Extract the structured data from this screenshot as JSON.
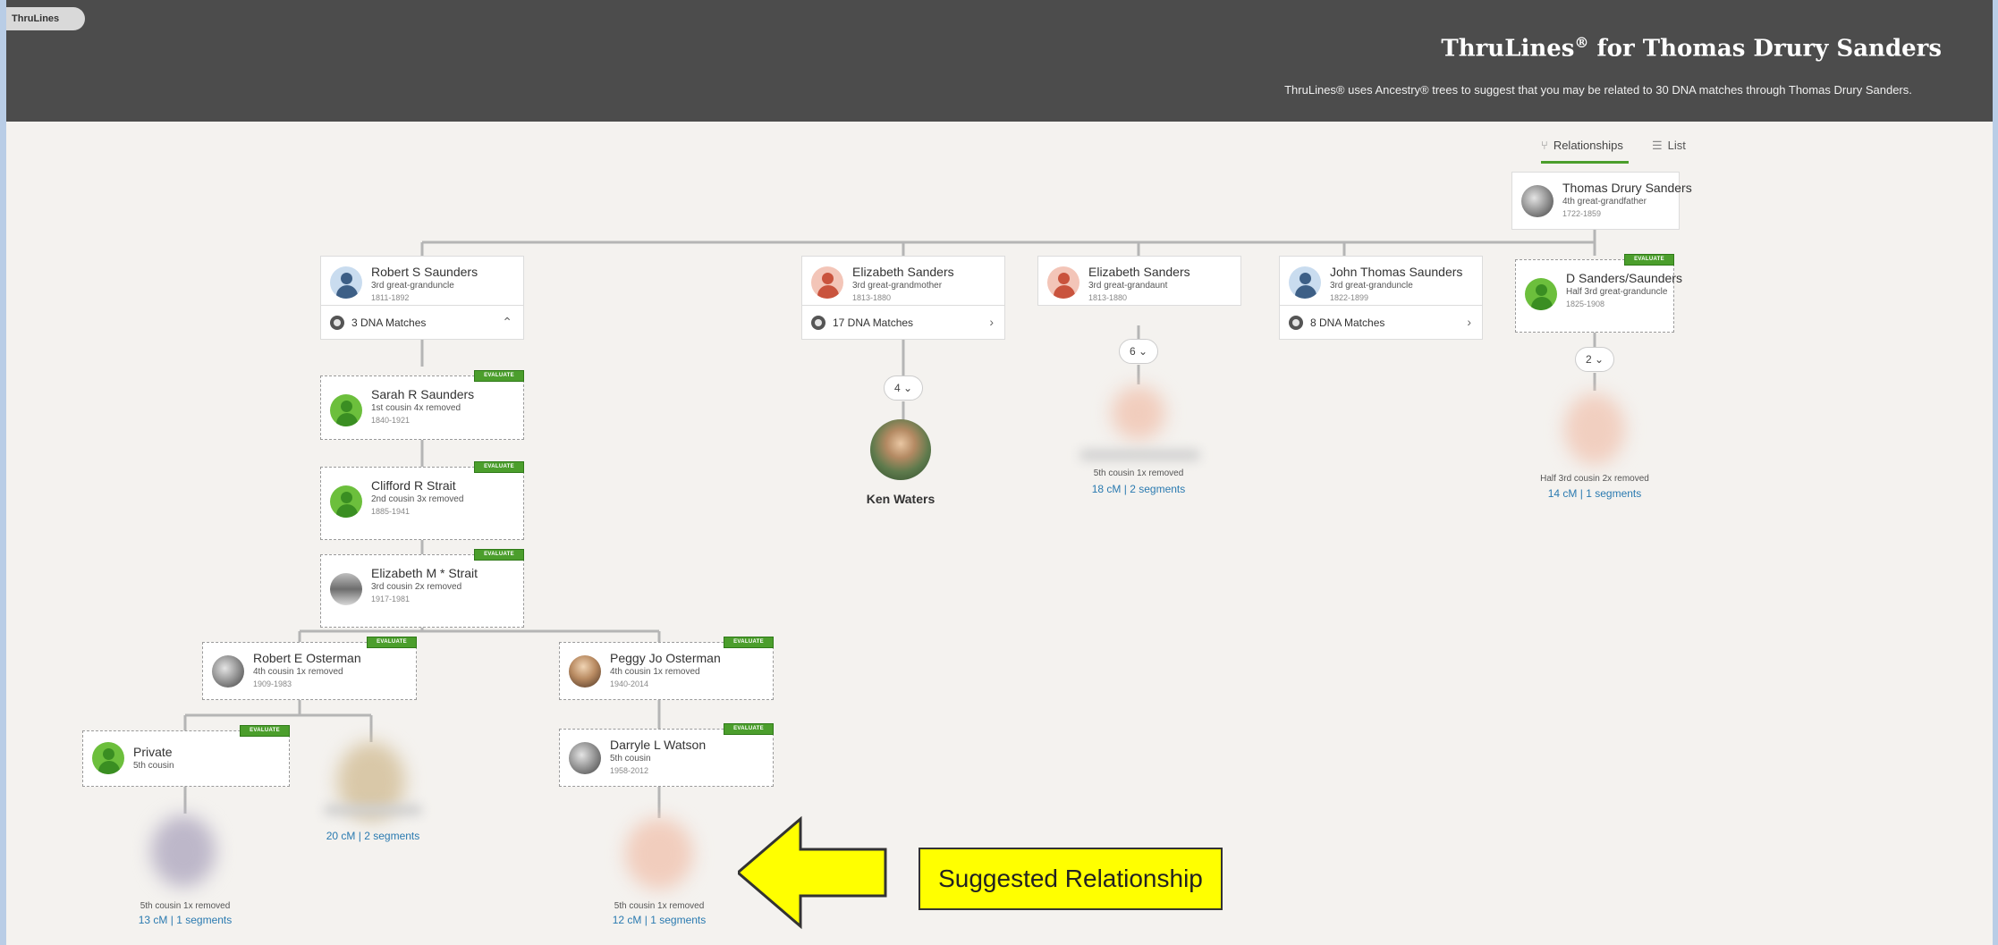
{
  "app": {
    "tab_label": "ThruLines"
  },
  "header": {
    "title_prefix": "ThruLines",
    "title_reg": "®",
    "title_suffix": " for Thomas Drury Sanders",
    "subtitle": "ThruLines® uses Ancestry® trees to suggest that you may be related to 30 DNA matches through Thomas Drury Sanders."
  },
  "view_tabs": [
    {
      "label": "Relationships",
      "icon": "tree-icon",
      "active": true
    },
    {
      "label": "List",
      "icon": "list-icon",
      "active": false
    }
  ],
  "badge_text": "EVALUATE",
  "root": {
    "name": "Thomas Drury Sanders",
    "relation": "4th great-grandfather",
    "dates": "1722-1859"
  },
  "branches": [
    {
      "name": "Robert S Saunders",
      "relation": "3rd great-granduncle",
      "dates": "1811-1892",
      "matches": "3 DNA Matches",
      "chevron": "⌃"
    },
    {
      "name": "Elizabeth Sanders",
      "relation": "3rd great-grandmother",
      "dates": "1813-1880",
      "matches": "17 DNA Matches",
      "chevron": "›"
    },
    {
      "name": "Elizabeth Sanders",
      "relation": "3rd great-grandaunt",
      "dates": "1813-1880",
      "count": "6"
    },
    {
      "name": "John Thomas Saunders",
      "relation": "3rd great-granduncle",
      "dates": "1822-1899",
      "matches": "8 DNA Matches",
      "chevron": "›"
    },
    {
      "name": "D Sanders/Saunders",
      "relation": "Half 3rd great-granduncle",
      "dates": "1825-1908",
      "count": "2"
    }
  ],
  "branch2_count": "4",
  "ken": {
    "name": "Ken Waters"
  },
  "match_aunt": {
    "relation": "5th cousin 1x removed",
    "cm": "18 cM | 2 segments"
  },
  "match_half": {
    "relation": "Half 3rd cousin 2x removed",
    "cm": "14 cM | 1 segments"
  },
  "chain": [
    {
      "name": "Sarah R Saunders",
      "relation": "1st cousin 4x removed",
      "dates": "1840-1921"
    },
    {
      "name": "Clifford R Strait",
      "relation": "2nd cousin 3x removed",
      "dates": "1885-1941"
    },
    {
      "name": "Elizabeth M * Strait",
      "relation": "3rd cousin 2x removed",
      "dates": "1917-1981"
    }
  ],
  "osterman": [
    {
      "name": "Robert E Osterman",
      "relation": "4th cousin 1x removed",
      "dates": "1909-1983"
    },
    {
      "name": "Peggy Jo Osterman",
      "relation": "4th cousin 1x removed",
      "dates": "1940-2014"
    }
  ],
  "private": {
    "name": "Private",
    "relation": "5th cousin"
  },
  "darryle": {
    "name": "Darryle L Watson",
    "relation": "5th cousin",
    "dates": "1958-2012"
  },
  "match_private": {
    "relation": "5th cousin 1x removed",
    "cm": "13 cM | 1 segments"
  },
  "match_robert": {
    "cm": "20 cM | 2 segments"
  },
  "match_darryle": {
    "relation": "5th cousin 1x removed",
    "cm": "12 cM | 1 segments"
  },
  "callout": {
    "text": "Suggested Relationship",
    "color": "#ffff00"
  },
  "colors": {
    "header": "#4c4c4c",
    "accent": "#4b9e2c",
    "link": "#2a7ab0",
    "frame": "#b9cde6"
  }
}
